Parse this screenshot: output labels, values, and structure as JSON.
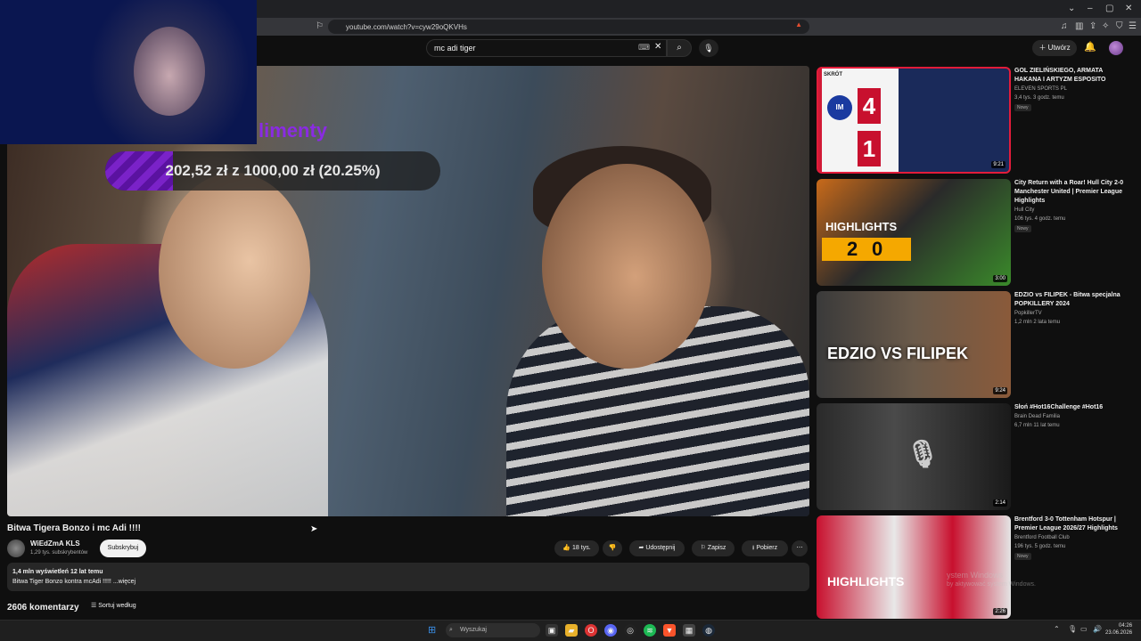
{
  "browser": {
    "url": "youtube.com/watch?v=cyw29oQKVHs"
  },
  "header": {
    "search_value": "mc adi tiger",
    "create_label": "Utwórz"
  },
  "video": {
    "title": "Bitwa Tigera Bonzo i mc Adi !!!!",
    "overlay_word": "limenty",
    "donation_text": "202,52 zł z 1000,00 zł (20.25%)",
    "donation_progress": 0.2025,
    "channel": "WiEdZmA KLS",
    "subscribers": "1,29 tys. subskrybentów",
    "subscribe_label": "Subskrybuj",
    "likes": "18 tys.",
    "share_label": "Udostępnij",
    "save_label": "Zapisz",
    "download_label": "Pobierz",
    "description_meta": "1,4 mln wyświetleń  12 lat temu",
    "description_text": "Bitwa Tiger Bonzo kontra mcAdi !!!!! ...więcej",
    "comments_count": "2606 komentarzy",
    "sort_label": "Sortuj według"
  },
  "recommendations": [
    {
      "title": "GOL ZIELIŃSKIEGO, ARMATA HAKANA I ARTYZM ESPOSITO",
      "channel": "ELEVEN SPORTS PL",
      "meta": "3,4 tys.  3 godz. temu",
      "badge": "Nowy",
      "duration": "9:21",
      "thumb_text": "SKRÓT",
      "score_home": "4",
      "score_away": "1"
    },
    {
      "title": "City Return with a Roar! Hull City 2-0 Manchester United | Premier League Highlights",
      "channel": "Hull City",
      "meta": "106 tys.  4 godz. temu",
      "badge": "Nowy",
      "duration": "3:00",
      "thumb_text": "HIGHLIGHTS",
      "score_home": "2",
      "score_away": "0"
    },
    {
      "title": "EDZIO vs FILIPEK - Bitwa specjalna POPKILLERY 2024",
      "channel": "PopkillerTV",
      "meta": "1,2 mln  2 lata temu",
      "badge": "",
      "duration": "9:24",
      "thumb_text": "EDZIO VS FILIPEK"
    },
    {
      "title": "Słoń #Hot16Challenge #Hot16",
      "channel": "Brain Dead Familia",
      "meta": "6,7 mln  11 lat temu",
      "badge": "",
      "duration": "2:14",
      "thumb_text": ""
    },
    {
      "title": "Brentford 3-0 Tottenham Hotspur | Premier League 2026/27 Highlights",
      "channel": "Brentford Football Club",
      "meta": "196 tys.  5 godz. temu",
      "badge": "Nowy",
      "duration": "2:26",
      "thumb_text": "HIGHLIGHTS"
    }
  ],
  "watermark": {
    "line1": "ystem Windows",
    "line2": "by aktywować system Windows."
  },
  "taskbar": {
    "search_placeholder": "Wyszukaj",
    "time": "04:26",
    "date": "23.06.2026"
  },
  "colors": {
    "accent_red": "#ff0000",
    "donation_purple": "#7a22c8"
  }
}
